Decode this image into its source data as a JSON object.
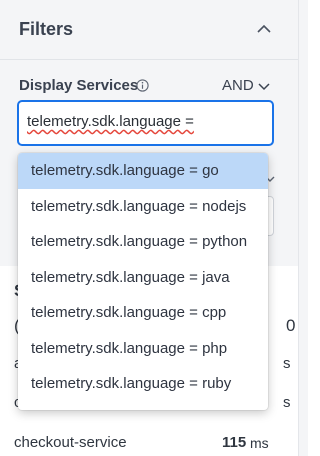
{
  "filters": {
    "title": "Filters",
    "display_services_label": "Display Services",
    "logic_operator": "AND",
    "query_value": "telemetry.sdk.language ="
  },
  "suggestions": [
    "telemetry.sdk.language = go",
    "telemetry.sdk.language = nodejs",
    "telemetry.sdk.language = python",
    "telemetry.sdk.language = java",
    "telemetry.sdk.language = cpp",
    "telemetry.sdk.language = php",
    "telemetry.sdk.language = ruby"
  ],
  "background_fragments": {
    "section_letter": "S",
    "paren": "(",
    "digit": "0",
    "row1_start": "a",
    "row1_end": "s",
    "row2_start": "c",
    "row2_end": "s"
  },
  "service_row": {
    "name": "checkout-service",
    "value": "115",
    "unit": "ms"
  },
  "colors": {
    "accent": "#1a73e8",
    "selected_option": "#bcd8f8",
    "header_bg": "#f4f5f7"
  }
}
